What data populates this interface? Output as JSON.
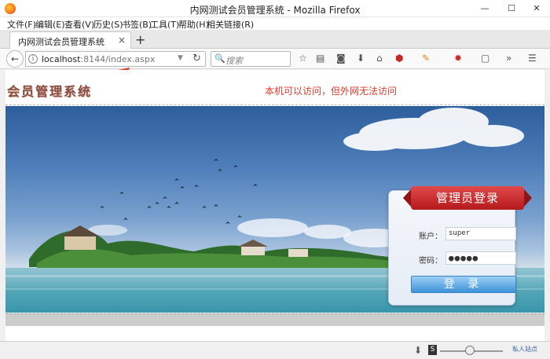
{
  "window": {
    "title": "内网测试会员管理系统 - Mozilla Firefox",
    "min": "—",
    "max": "☐",
    "close": "✕"
  },
  "menu": [
    "文件(F)",
    "编辑(E)",
    "查看(V)",
    "历史(S)",
    "书签(B)",
    "工具(T)",
    "帮助(H)",
    "相关链接(R)"
  ],
  "tab": {
    "title": "内网测试会员管理系统",
    "close": "×",
    "new": "+"
  },
  "nav": {
    "back": "←",
    "url_host": "localhost",
    "url_path": ":8144/index.aspx",
    "reload": "↻",
    "search_placeholder": "搜索"
  },
  "page": {
    "system_title": "会员管理系统",
    "annotation": "本机可以访问，但外网无法访问",
    "login": {
      "title": "管理员登录",
      "account_label": "账户：",
      "account_value": "super",
      "password_label": "密码：",
      "password_value": "●●●●●",
      "submit_label": "登 录"
    }
  },
  "status": {
    "zoom_badge": "私人站点"
  },
  "colors": {
    "annotation": "#e03a2a",
    "login_ribbon": "#c4262a",
    "login_button": "#3d92d8",
    "system_title": "#8a4a40"
  }
}
